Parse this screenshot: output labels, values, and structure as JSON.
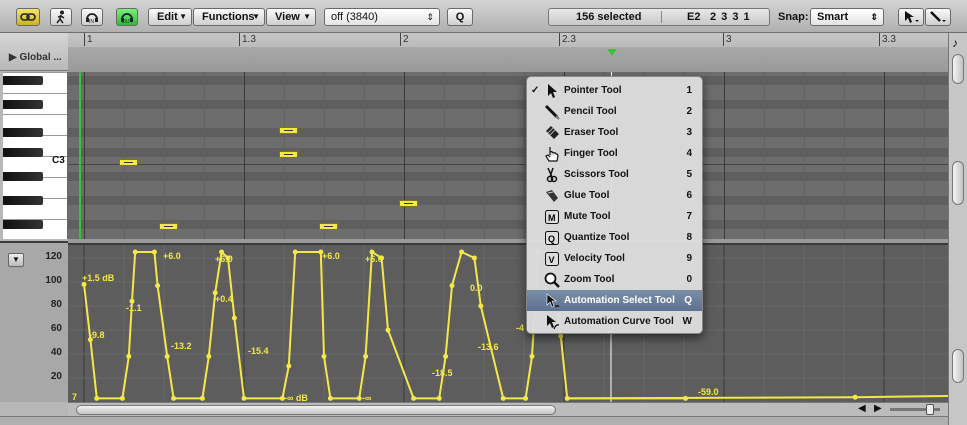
{
  "toolbar": {
    "edit_menu": "Edit",
    "functions_menu": "Functions",
    "view_menu": "View",
    "quantize_value": "off (3840)",
    "q_button": "Q",
    "selection_count": "156 selected",
    "position_pitch": "E2",
    "position_value": "2 3 3 1",
    "snap_label": "Snap:",
    "snap_value": "Smart"
  },
  "global_tracks_label": "Global ...",
  "keyboard": {
    "c3_label": "C3"
  },
  "ruler": {
    "markers": [
      "1",
      "1.3",
      "2",
      "2.3",
      "3",
      "3.3"
    ]
  },
  "automation": {
    "scale_ticks": [
      "120",
      "100",
      "80",
      "60",
      "40",
      "20"
    ],
    "value_labels": [
      "+1.5 dB",
      "-9.8",
      "-1.1",
      "+6.0",
      "-13.2",
      "+6.0",
      "+0.4",
      "-15.4",
      "-∞ dB",
      "+6.0",
      "+6.0",
      "-∞",
      "-18.5",
      "0.0",
      "-13.6",
      "-4",
      "-59.0",
      "7"
    ],
    "series": [
      {
        "name": "",
        "points": [
          [
            1.0,
            98
          ],
          [
            1.02,
            52
          ],
          [
            1.04,
            3
          ],
          [
            1.12,
            3
          ],
          [
            1.14,
            38
          ],
          [
            1.15,
            84
          ],
          [
            1.16,
            125
          ],
          [
            1.22,
            125
          ],
          [
            1.23,
            97
          ],
          [
            1.26,
            38
          ],
          [
            1.28,
            3
          ],
          [
            1.37,
            3
          ],
          [
            1.39,
            38
          ],
          [
            1.41,
            91
          ],
          [
            1.43,
            125
          ],
          [
            1.45,
            120
          ],
          [
            1.47,
            70
          ],
          [
            1.5,
            3
          ],
          [
            1.62,
            3
          ],
          [
            1.64,
            30
          ],
          [
            1.66,
            125
          ],
          [
            1.74,
            125
          ],
          [
            1.75,
            38
          ],
          [
            1.77,
            3
          ],
          [
            1.86,
            3
          ],
          [
            1.88,
            38
          ],
          [
            1.9,
            125
          ],
          [
            1.93,
            120
          ],
          [
            1.95,
            60
          ],
          [
            2.03,
            3
          ],
          [
            2.11,
            3
          ],
          [
            2.13,
            38
          ],
          [
            2.15,
            97
          ],
          [
            2.18,
            125
          ],
          [
            2.22,
            120
          ],
          [
            2.24,
            80
          ],
          [
            2.31,
            3
          ],
          [
            2.38,
            3
          ],
          [
            2.4,
            38
          ],
          [
            2.42,
            125
          ],
          [
            2.46,
            125
          ],
          [
            2.49,
            55
          ],
          [
            2.51,
            3
          ],
          [
            2.88,
            3
          ]
        ]
      }
    ]
  },
  "tool_menu": {
    "items": [
      {
        "label": "Pointer Tool",
        "key": "1",
        "checked": "✓",
        "icon": "pointer-icon"
      },
      {
        "label": "Pencil Tool",
        "key": "2",
        "checked": "",
        "icon": "pencil-icon"
      },
      {
        "label": "Eraser Tool",
        "key": "3",
        "checked": "",
        "icon": "eraser-icon"
      },
      {
        "label": "Finger Tool",
        "key": "4",
        "checked": "",
        "icon": "finger-icon"
      },
      {
        "label": "Scissors Tool",
        "key": "5",
        "checked": "",
        "icon": "scissors-icon"
      },
      {
        "label": "Glue Tool",
        "key": "6",
        "checked": "",
        "icon": "glue-icon"
      },
      {
        "label": "Mute Tool",
        "key": "7",
        "checked": "",
        "icon": "mute-icon"
      },
      {
        "label": "Quantize Tool",
        "key": "8",
        "checked": "",
        "icon": "quantize-icon"
      },
      {
        "label": "Velocity Tool",
        "key": "9",
        "checked": "",
        "icon": "velocity-icon"
      },
      {
        "label": "Zoom Tool",
        "key": "0",
        "checked": "",
        "icon": "zoom-icon"
      },
      {
        "label": "Automation Select Tool",
        "key": "Q",
        "checked": "",
        "icon": "automation-select-icon"
      },
      {
        "label": "Automation Curve Tool",
        "key": "W",
        "checked": "",
        "icon": "automation-curve-icon"
      }
    ],
    "selected_index": 10
  },
  "colors": {
    "note_fill": "#f3e84a",
    "automation_line": "#f3e84a",
    "playhead": "#3ebd3e",
    "menu_highlight": "#6a7f9c"
  }
}
